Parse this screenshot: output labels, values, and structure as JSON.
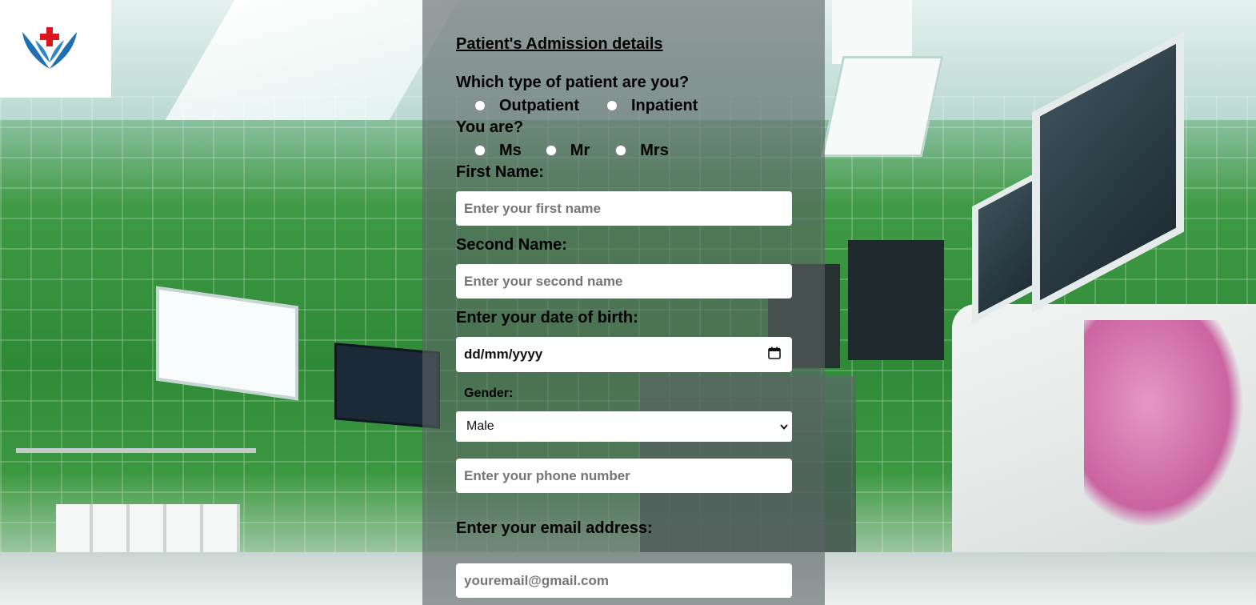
{
  "form": {
    "heading": "Patient's Admission details",
    "patient_type": {
      "question": "Which type of patient are you?",
      "options": [
        "Outpatient",
        "Inpatient"
      ]
    },
    "title": {
      "question": "You are?",
      "options": [
        "Ms",
        "Mr",
        "Mrs"
      ]
    },
    "first_name": {
      "label": "First Name:",
      "placeholder": "Enter your first name"
    },
    "second_name": {
      "label": "Second Name:",
      "placeholder": "Enter your second name"
    },
    "dob": {
      "label": "Enter your date of birth:",
      "placeholder": "dd/mm/yyyy"
    },
    "gender": {
      "label": "Gender:",
      "selected": "Male"
    },
    "phone": {
      "placeholder": "Enter your phone number"
    },
    "email": {
      "label": "Enter your email address:",
      "placeholder": "youremail@gmail.com"
    }
  },
  "icons": {
    "logo": "medical-cross-wings-logo",
    "calendar": "calendar-icon",
    "chevron": "chevron-down-icon"
  },
  "colors": {
    "logo_cross": "#e0121b",
    "logo_wings": "#1f6fb2",
    "panel_overlay": "#5a6464"
  }
}
